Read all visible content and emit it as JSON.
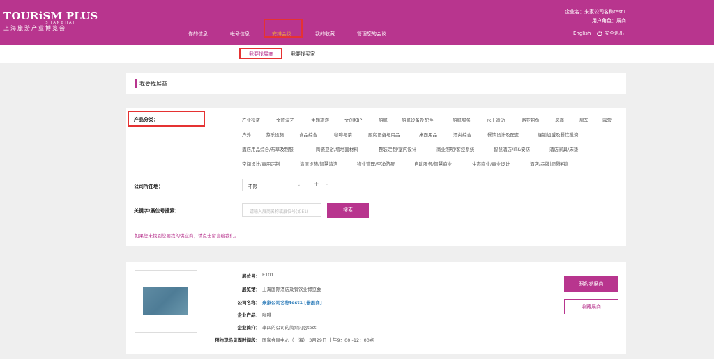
{
  "brand": {
    "name": "TOURiSM PLUS",
    "city": "SHANGHAI",
    "subtitle": "上海旅游产业博览会"
  },
  "nav": {
    "items": [
      "你的信息",
      "帐号信息",
      "安排会议",
      "我的收藏",
      "管理您的会议"
    ],
    "active_index": 2
  },
  "user": {
    "company_line": "企业名：来家公司名称test1",
    "role_line": "用户角色：展商"
  },
  "header_actions": {
    "language": "English",
    "logout": "安全退出"
  },
  "subnav": {
    "tabs": [
      "我要找展商",
      "我要找买家"
    ],
    "active_index": 0
  },
  "panel": {
    "title": "我要找展商"
  },
  "filters": {
    "category_label": "产品分类：",
    "categories": [
      "产业投资",
      "文旅演艺",
      "主题旅游",
      "文创和IP",
      "船艇",
      "船艇设备及配件",
      "船艇服务",
      "水上运动",
      "路亚钓鱼",
      "风商",
      "房车",
      "露营",
      "户外",
      "游乐设施",
      "食品综合",
      "咖啡与茶",
      "厨房设备与用品",
      "桌面用品",
      "酒类综合",
      "餐饮设计及配套",
      "连锁加盟及餐饮投资",
      "酒店用品综合/布草及制服",
      "陶瓷卫浴/墙地面材料",
      "整装定制/室内设计",
      "商业照明/客控系统",
      "智慧酒店/IT&安防",
      "酒店家具/床垫",
      "空间设计/商用定制",
      "清洁设施/智慧清洁",
      "物业管理/空净防疫",
      "自助服务/智慧商业",
      "生态商业/商业设计",
      "酒店/品牌加盟连锁"
    ],
    "location_label": "公司所在地：",
    "location_value": "不限",
    "plus": "+",
    "minus": "-",
    "keyword_label": "关键字/展位号搜索：",
    "keyword_placeholder": "请输入展商名称或展位号(如E1)",
    "search_button": "搜索",
    "hint": "如果您未找到您要找的供应商，请点击留言给我们。"
  },
  "result": {
    "booth_label": "展位号：",
    "booth_value": "E101",
    "hall_label": "展览馆：",
    "hall_value": "上海国际酒店及餐饮业博览会",
    "company_label": "公司名称：",
    "company_value": "来家公司名称test1 [参展商]",
    "product_label": "企业产品：",
    "product_value": "咖啡",
    "intro_label": "企业简介：",
    "intro_value": "李四的公司的简介内容test",
    "time_label": "预约现场见面时间段：",
    "time_value": "国家会展中心（上海） 3月29日 上午9：00 -12：00点",
    "book_button": "预约参展商",
    "fav_button": "收藏展商"
  },
  "colors": {
    "brand": "#b8358e",
    "nav_active": "#f3a33d",
    "highlight_box": "#e53232",
    "link": "#2a7ab8"
  }
}
